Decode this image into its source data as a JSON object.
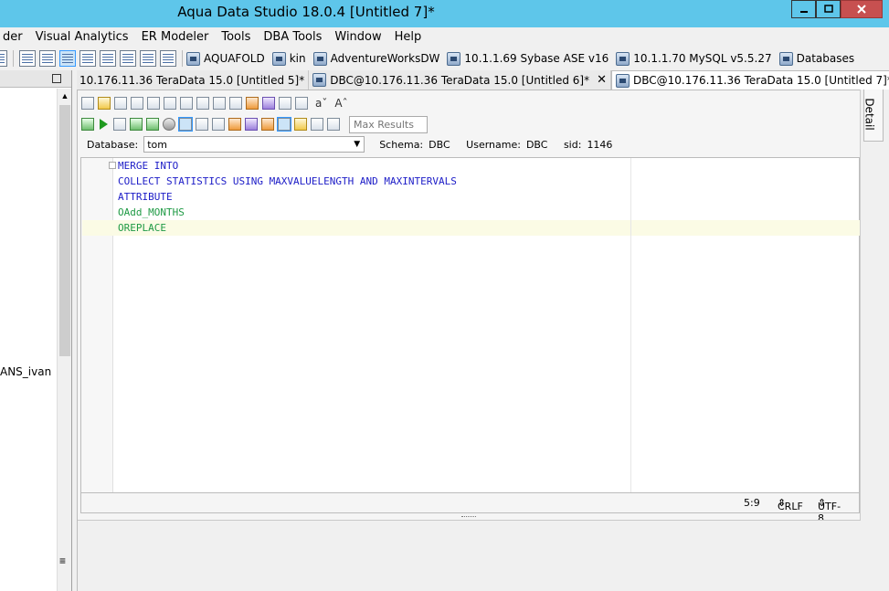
{
  "window": {
    "title": "Aqua Data Studio 18.0.4 [Untitled 7]*"
  },
  "menu": {
    "items": [
      "der",
      "Visual Analytics",
      "ER Modeler",
      "Tools",
      "DBA Tools",
      "Window",
      "Help"
    ]
  },
  "servers": [
    "AQUAFOLD",
    "kin",
    "AdventureWorksDW",
    "10.1.1.69 Sybase ASE v16",
    "10.1.1.70 MySQL v5.5.27",
    "Databases"
  ],
  "tree": {
    "visible_item": "ANS_ivan"
  },
  "tabs": [
    {
      "label": "10.176.11.36 TeraData 15.0 [Untitled 5]*",
      "active": false
    },
    {
      "label": "DBC@10.176.11.36 TeraData 15.0 [Untitled 6]*",
      "active": false
    },
    {
      "label": "DBC@10.176.11.36 TeraData 15.0 [Untitled 7]*",
      "active": true
    }
  ],
  "toolbar": {
    "max_results_placeholder": "Max Results"
  },
  "connection": {
    "database_label": "Database:",
    "database_value": "tom",
    "schema_label": "Schema:",
    "schema_value": "DBC",
    "username_label": "Username:",
    "username_value": "DBC",
    "sid_label": "sid:",
    "sid_value": "1146"
  },
  "editor": {
    "lines": [
      {
        "text": "MERGE INTO",
        "kind": "keyword"
      },
      {
        "text": "COLLECT STATISTICS USING MAXVALUELENGTH AND MAXINTERVALS",
        "kind": "keyword"
      },
      {
        "text": "ATTRIBUTE",
        "kind": "keyword"
      },
      {
        "text": "OAdd_MONTHS",
        "kind": "function"
      },
      {
        "text": "OREPLACE",
        "kind": "function"
      }
    ],
    "cursor_position": "5:9",
    "line_ending": "CRLF",
    "encoding": "UTF-8"
  },
  "right_panel": {
    "detail_tab": "Detail"
  },
  "colors": {
    "titlebar": "#5ec6ea",
    "keyword": "#1c1cc7",
    "function": "#1f9a45",
    "current_line": "#fbfbe5"
  }
}
